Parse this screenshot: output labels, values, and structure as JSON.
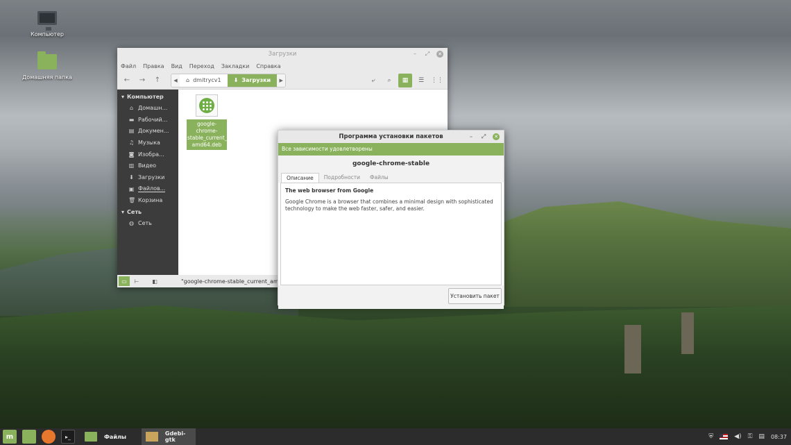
{
  "desktop": {
    "icons": [
      {
        "label": "Компьютер"
      },
      {
        "label": "Домашняя папка"
      }
    ]
  },
  "file_manager": {
    "title": "Загрузки",
    "menu": [
      "Файл",
      "Правка",
      "Вид",
      "Переход",
      "Закладки",
      "Справка"
    ],
    "breadcrumbs": [
      "dmitrycv1",
      "Загрузки"
    ],
    "sidebar": {
      "computer_header": "Компьютер",
      "items": [
        "Домашн...",
        "Рабочий...",
        "Докумен...",
        "Музыка",
        "Изобра...",
        "Видео",
        "Загрузки",
        "Файлов...",
        "Корзина"
      ],
      "network_header": "Сеть",
      "network_items": [
        "Сеть"
      ]
    },
    "file": {
      "name": "google-chrome-stable_current_amd64.deb",
      "label_lines": [
        "google-chrome-",
        "stable_current_",
        "amd64.deb"
      ]
    },
    "status_text": "\"google-chrome-stable_current_amd64.d"
  },
  "gdebi": {
    "title": "Программа установки пакетов",
    "status": "Все зависимости удовлетворены",
    "package": "google-chrome-stable",
    "tabs": [
      "Описание",
      "Подробности",
      "Файлы"
    ],
    "summary": "The web browser from Google",
    "description": "Google Chrome is a browser that combines a minimal design with sophisticated technology to make the web faster, safer, and easier.",
    "install_button": "Установить пакет"
  },
  "taskbar": {
    "tasks": [
      "Файлы",
      "Gdebi-gtk"
    ],
    "clock": "08:37"
  },
  "colors": {
    "accent": "#8ab25c",
    "sidebar_bg": "#3c3c3c",
    "taskbar_bg": "#2c2c2c"
  }
}
